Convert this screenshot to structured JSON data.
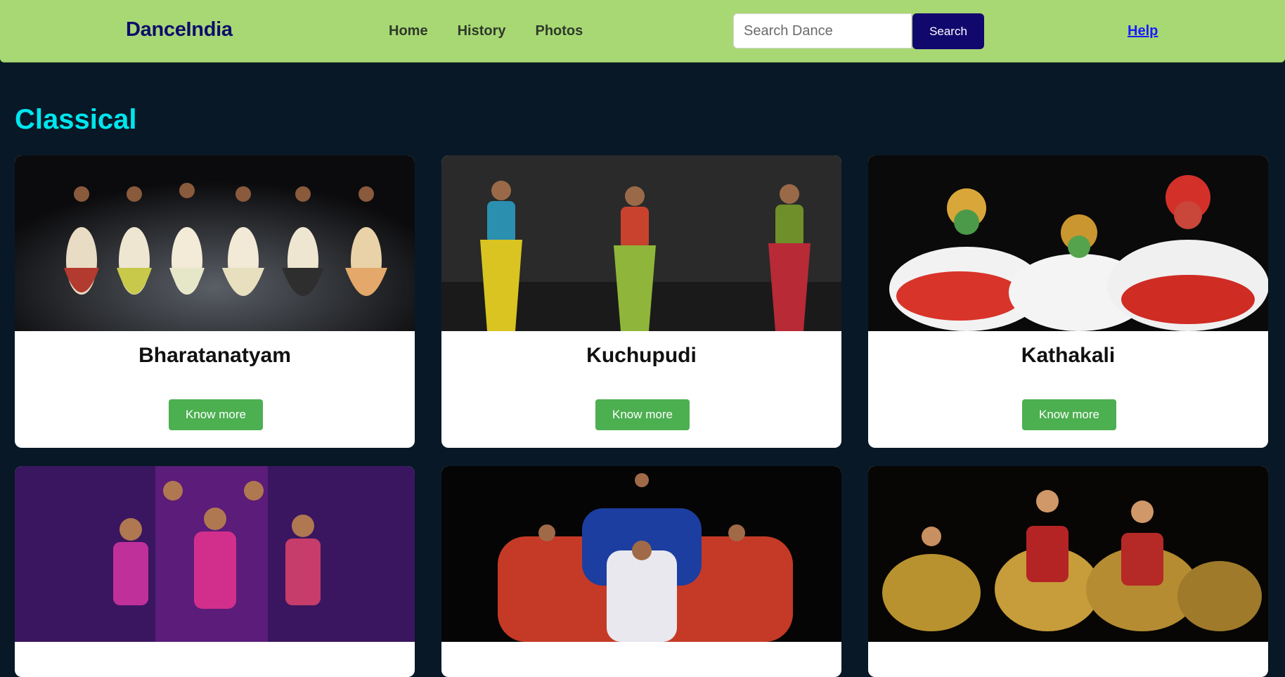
{
  "header": {
    "brand": "DanceIndia",
    "nav": [
      "Home",
      "History",
      "Photos"
    ],
    "search_placeholder": "Search Dance",
    "search_value": "",
    "search_button": "Search",
    "help": "Help"
  },
  "section": {
    "title": "Classical"
  },
  "cards": [
    {
      "title": "Bharatanatyam",
      "button": "Know more"
    },
    {
      "title": "Kuchupudi",
      "button": "Know more"
    },
    {
      "title": "Kathakali",
      "button": "Know more"
    },
    {
      "title": "",
      "button": ""
    },
    {
      "title": "",
      "button": ""
    },
    {
      "title": "",
      "button": ""
    }
  ],
  "colors": {
    "navbar": "#a8d874",
    "page_background": "#081826",
    "brand": "#0d0d6b",
    "section_title": "#00e6ee",
    "search_button": "#11086e",
    "know_more_button": "#4caf50",
    "help_link": "#1a1aff"
  }
}
